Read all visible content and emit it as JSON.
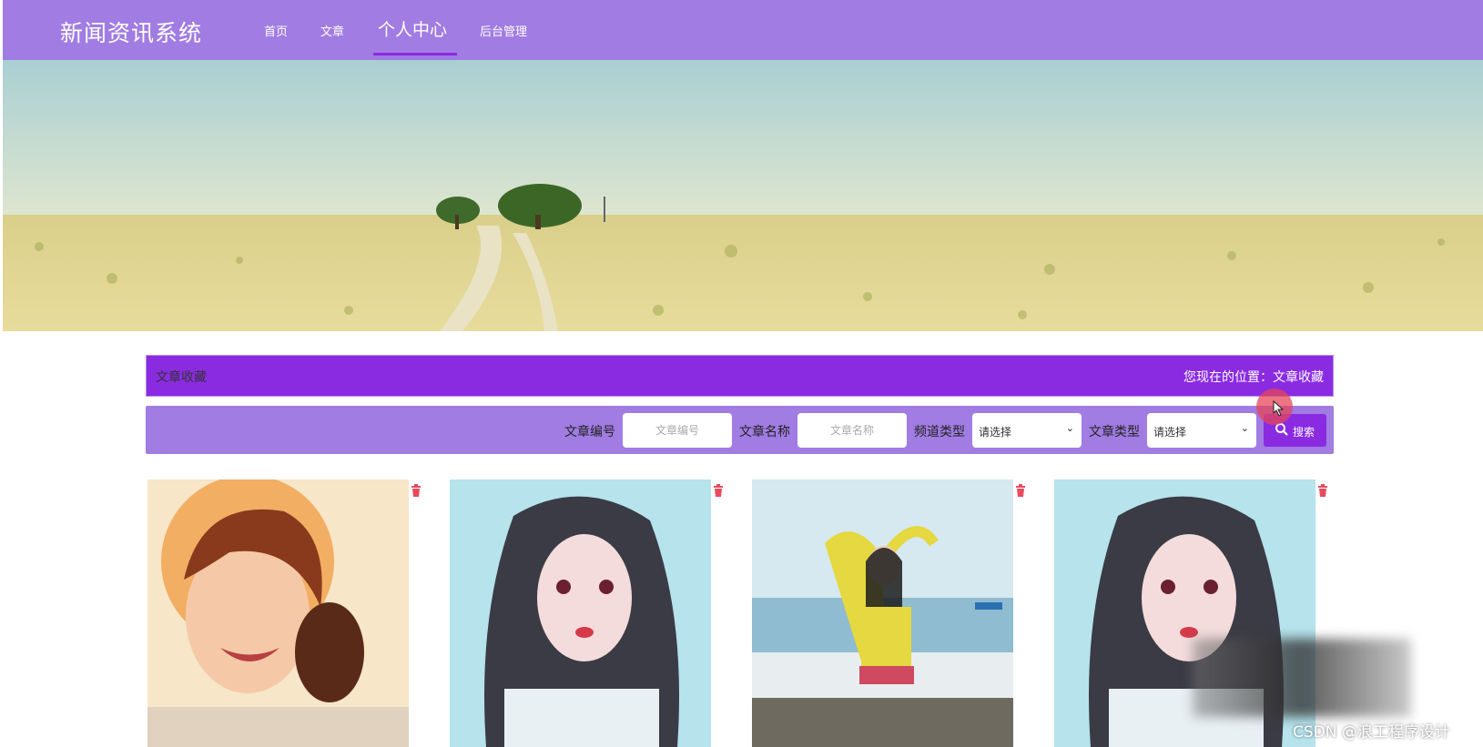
{
  "header": {
    "site_title": "新闻资讯系统",
    "nav": [
      {
        "label": "首页",
        "active": false
      },
      {
        "label": "文章",
        "active": false
      },
      {
        "label": "个人中心",
        "active": true
      },
      {
        "label": "后台管理",
        "active": false
      }
    ],
    "colors": {
      "bar": "#a17ce3",
      "accent": "#8a2be2"
    }
  },
  "banner": {
    "slide_count": 3,
    "active_slide": 1
  },
  "section": {
    "title": "文章收藏",
    "breadcrumb": "您现在的位置：文章收藏"
  },
  "search": {
    "fields": [
      {
        "label": "文章编号",
        "placeholder": "文章编号"
      },
      {
        "label": "文章名称",
        "placeholder": "文章名称"
      }
    ],
    "selects": [
      {
        "label": "频道类型",
        "value": "请选择"
      },
      {
        "label": "文章类型",
        "value": "请选择"
      }
    ],
    "button_label": "搜索"
  },
  "cards": [
    {
      "icon": "delete-icon"
    },
    {
      "icon": "delete-icon"
    },
    {
      "icon": "delete-icon"
    },
    {
      "icon": "delete-icon"
    }
  ],
  "watermark": "CSDN @浪工程序设计"
}
